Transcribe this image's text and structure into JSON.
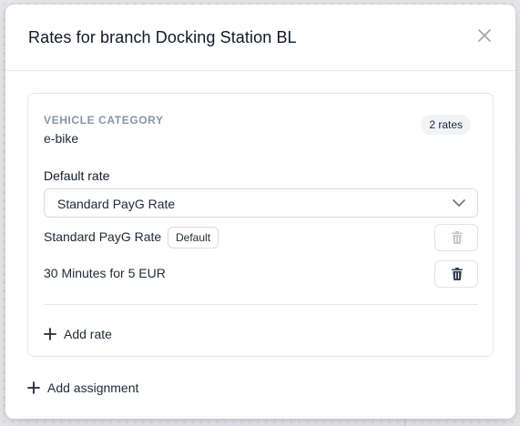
{
  "modal": {
    "title": "Rates for branch Docking Station BL",
    "close_icon": "close-icon"
  },
  "category_card": {
    "category_label": "VEHICLE CATEGORY",
    "category_value": "e-bike",
    "rate_count": "2 rates",
    "default_rate_label": "Default rate",
    "default_rate_select": {
      "selected": "Standard PayG Rate",
      "icon": "chevron-down-icon"
    },
    "rates": [
      {
        "name": "Standard PayG Rate",
        "badge": "Default",
        "delete_enabled": false,
        "icon": "trash-icon"
      },
      {
        "name": "30 Minutes for 5 EUR",
        "badge": "",
        "delete_enabled": true,
        "icon": "trash-icon"
      }
    ],
    "add_rate_label": "Add rate"
  },
  "add_assignment_label": "Add assignment",
  "colors": {
    "text_primary": "#1f2937",
    "text_muted": "#8b94a3",
    "border": "#e5e7eb",
    "badge_bg": "#f1f3f6",
    "disabled_icon": "#c4c9d1"
  }
}
